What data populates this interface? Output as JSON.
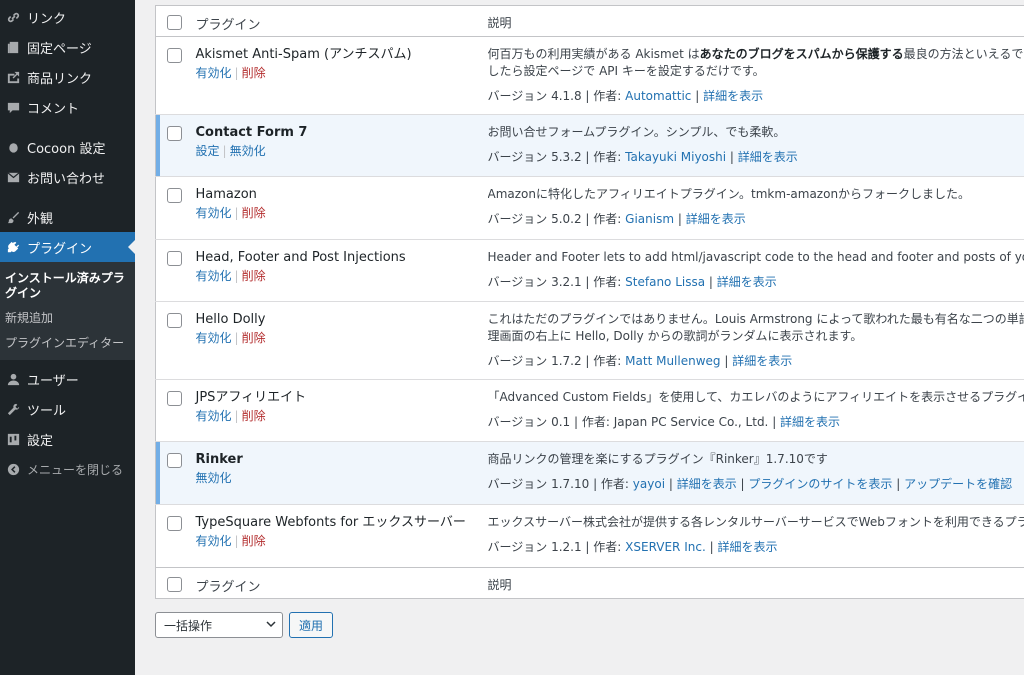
{
  "sidebar": {
    "menu_top": [
      {
        "label": "リンク",
        "icon": "link-icon"
      },
      {
        "label": "固定ページ",
        "icon": "page-icon"
      },
      {
        "label": "商品リンク",
        "icon": "product-link-icon"
      },
      {
        "label": "コメント",
        "icon": "comment-icon"
      }
    ],
    "cocoon": "Cocoon 設定",
    "contact": "お問い合わせ",
    "appearance": "外観",
    "plugins": "プラグイン",
    "submenu": [
      "インストール済みプラグイン",
      "新規追加",
      "プラグインエディター"
    ],
    "users": "ユーザー",
    "tools": "ツール",
    "settings": "設定",
    "collapse": "メニューを閉じる"
  },
  "table": {
    "col_plugin": "プラグイン",
    "col_desc": "説明",
    "plugins": [
      {
        "name": "Akismet Anti-Spam (アンチスパム)",
        "active": false,
        "actions": [
          {
            "label": "有効化",
            "type": "link"
          },
          {
            "label": "削除",
            "type": "delete"
          }
        ],
        "desc_1_pre": "何百万もの利用実績がある Akismet は",
        "desc_1_bold": "あなたのブログをスパムから保護する",
        "desc_1_post": "最良の方法といえるでしょう。あな",
        "desc_2": "したら設定ページで API キーを設定するだけです。",
        "version": "バージョン 4.1.8",
        "author_label": "作者:",
        "author": "Automattic",
        "details": "詳細を表示"
      },
      {
        "name": "Contact Form 7",
        "active": true,
        "actions": [
          {
            "label": "設定",
            "type": "link"
          },
          {
            "label": "無効化",
            "type": "link"
          }
        ],
        "desc_1": "お問い合せフォームプラグイン。シンプル、でも柔軟。",
        "version": "バージョン 5.3.2",
        "author_label": "作者:",
        "author": "Takayuki Miyoshi",
        "details": "詳細を表示"
      },
      {
        "name": "Hamazon",
        "active": false,
        "actions": [
          {
            "label": "有効化",
            "type": "link"
          },
          {
            "label": "削除",
            "type": "delete"
          }
        ],
        "desc_1": "Amazonに特化したアフィリエイトプラグイン。tmkm-amazonからフォークしました。",
        "version": "バージョン 5.0.2",
        "author_label": "作者:",
        "author": "Gianism",
        "details": "詳細を表示"
      },
      {
        "name": "Head, Footer and Post Injections",
        "active": false,
        "actions": [
          {
            "label": "有効化",
            "type": "link"
          },
          {
            "label": "削除",
            "type": "delete"
          }
        ],
        "desc_1": "Header and Footer lets to add html/javascript code to the head and footer and posts of your blog. Some examples",
        "version": "バージョン 3.2.1",
        "author_label": "作者:",
        "author": "Stefano Lissa",
        "details": "詳細を表示"
      },
      {
        "name": "Hello Dolly",
        "active": false,
        "actions": [
          {
            "label": "有効化",
            "type": "link"
          },
          {
            "label": "削除",
            "type": "delete"
          }
        ],
        "desc_1": "これはただのプラグインではありません。Louis Armstrong によって歌われた最も有名な二つの単語、Hello, Dolly",
        "desc_2": "理画面の右上に Hello, Dolly からの歌詞がランダムに表示されます。",
        "version": "バージョン 1.7.2",
        "author_label": "作者:",
        "author": "Matt Mullenweg",
        "details": "詳細を表示"
      },
      {
        "name": "JPSアフィリエイト",
        "active": false,
        "actions": [
          {
            "label": "有効化",
            "type": "link"
          },
          {
            "label": "削除",
            "type": "delete"
          }
        ],
        "desc_1": "「Advanced Custom Fields」を使用して、カエレバのようにアフィリエイトを表示させるプラグイン。",
        "version": "バージョン 0.1",
        "author_label": "作者:",
        "author_plain": "Japan PC Service Co., Ltd.",
        "details": "詳細を表示"
      },
      {
        "name": "Rinker",
        "active": true,
        "actions": [
          {
            "label": "無効化",
            "type": "link"
          }
        ],
        "desc_1": "商品リンクの管理を楽にするプラグイン『Rinker』1.7.10です",
        "version": "バージョン 1.7.10",
        "author_label": "作者:",
        "author": "yayoi",
        "details": "詳細を表示",
        "extra_links": [
          "プラグインのサイトを表示",
          "アップデートを確認"
        ]
      },
      {
        "name": "TypeSquare Webfonts for エックスサーバー",
        "active": false,
        "actions": [
          {
            "label": "有効化",
            "type": "link"
          },
          {
            "label": "削除",
            "type": "delete"
          }
        ],
        "desc_1": "エックスサーバー株式会社が提供する各レンタルサーバーサービスでWebフォントを利用できるプラグインです。",
        "version": "バージョン 1.2.1",
        "author_label": "作者:",
        "author": "XSERVER Inc.",
        "details": "詳細を表示"
      }
    ]
  },
  "bulk": {
    "select_value": "一括操作",
    "apply": "適用"
  },
  "colors": {
    "sidebar_bg": "#1d2327",
    "accent": "#2271b1",
    "delete": "#b32d2e",
    "active_row_bg": "#f0f6fc",
    "active_row_border": "#72aee6"
  }
}
